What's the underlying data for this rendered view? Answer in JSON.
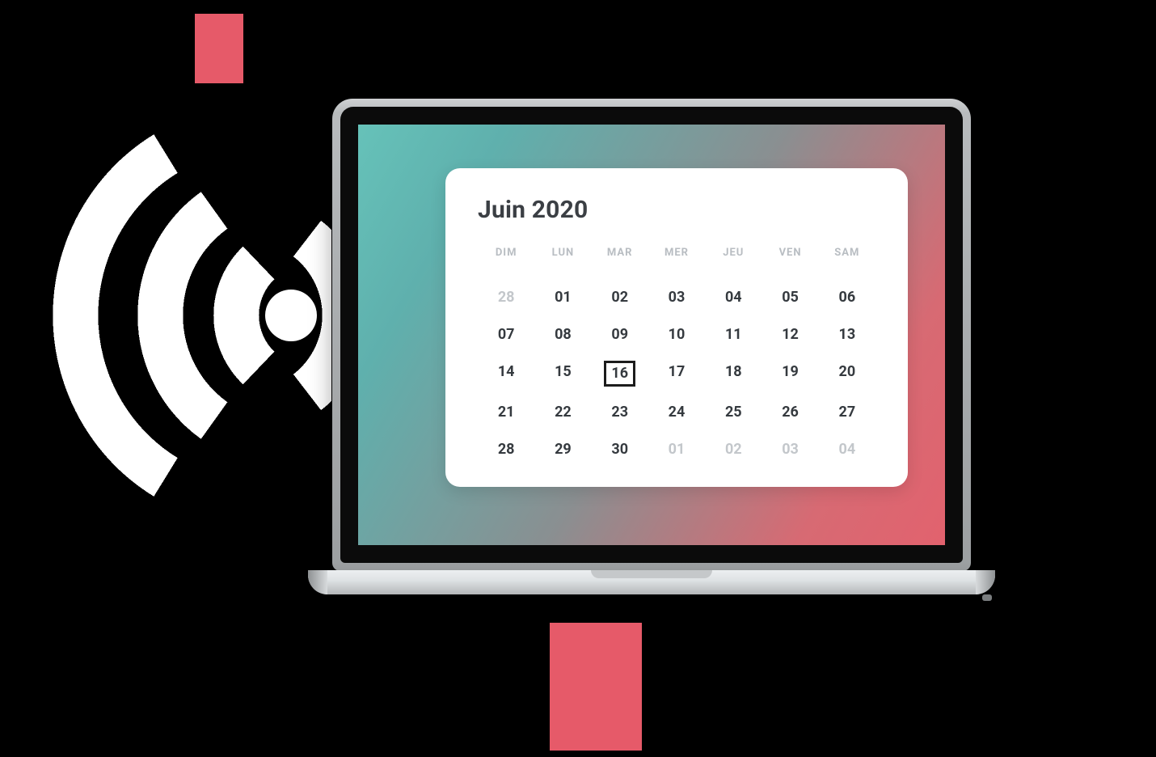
{
  "decor": {
    "accent_color": "#E65A69",
    "screen_gradient_from": "#66c2b9",
    "screen_gradient_to": "#e2626e"
  },
  "calendar": {
    "title": "Juin 2020",
    "weekdays": [
      "DIM",
      "LUN",
      "MAR",
      "MER",
      "JEU",
      "VEN",
      "SAM"
    ],
    "selected_day": "16",
    "weeks": [
      [
        {
          "d": "28",
          "out": true
        },
        {
          "d": "01"
        },
        {
          "d": "02"
        },
        {
          "d": "03"
        },
        {
          "d": "04"
        },
        {
          "d": "05"
        },
        {
          "d": "06"
        }
      ],
      [
        {
          "d": "07"
        },
        {
          "d": "08"
        },
        {
          "d": "09"
        },
        {
          "d": "10"
        },
        {
          "d": "11"
        },
        {
          "d": "12"
        },
        {
          "d": "13"
        }
      ],
      [
        {
          "d": "14"
        },
        {
          "d": "15"
        },
        {
          "d": "16",
          "sel": true
        },
        {
          "d": "17"
        },
        {
          "d": "18"
        },
        {
          "d": "19"
        },
        {
          "d": "20"
        }
      ],
      [
        {
          "d": "21"
        },
        {
          "d": "22"
        },
        {
          "d": "23"
        },
        {
          "d": "24"
        },
        {
          "d": "25"
        },
        {
          "d": "26"
        },
        {
          "d": "27"
        }
      ],
      [
        {
          "d": "28"
        },
        {
          "d": "29"
        },
        {
          "d": "30"
        },
        {
          "d": "01",
          "out": true
        },
        {
          "d": "02",
          "out": true
        },
        {
          "d": "03",
          "out": true
        },
        {
          "d": "04",
          "out": true
        }
      ]
    ]
  }
}
